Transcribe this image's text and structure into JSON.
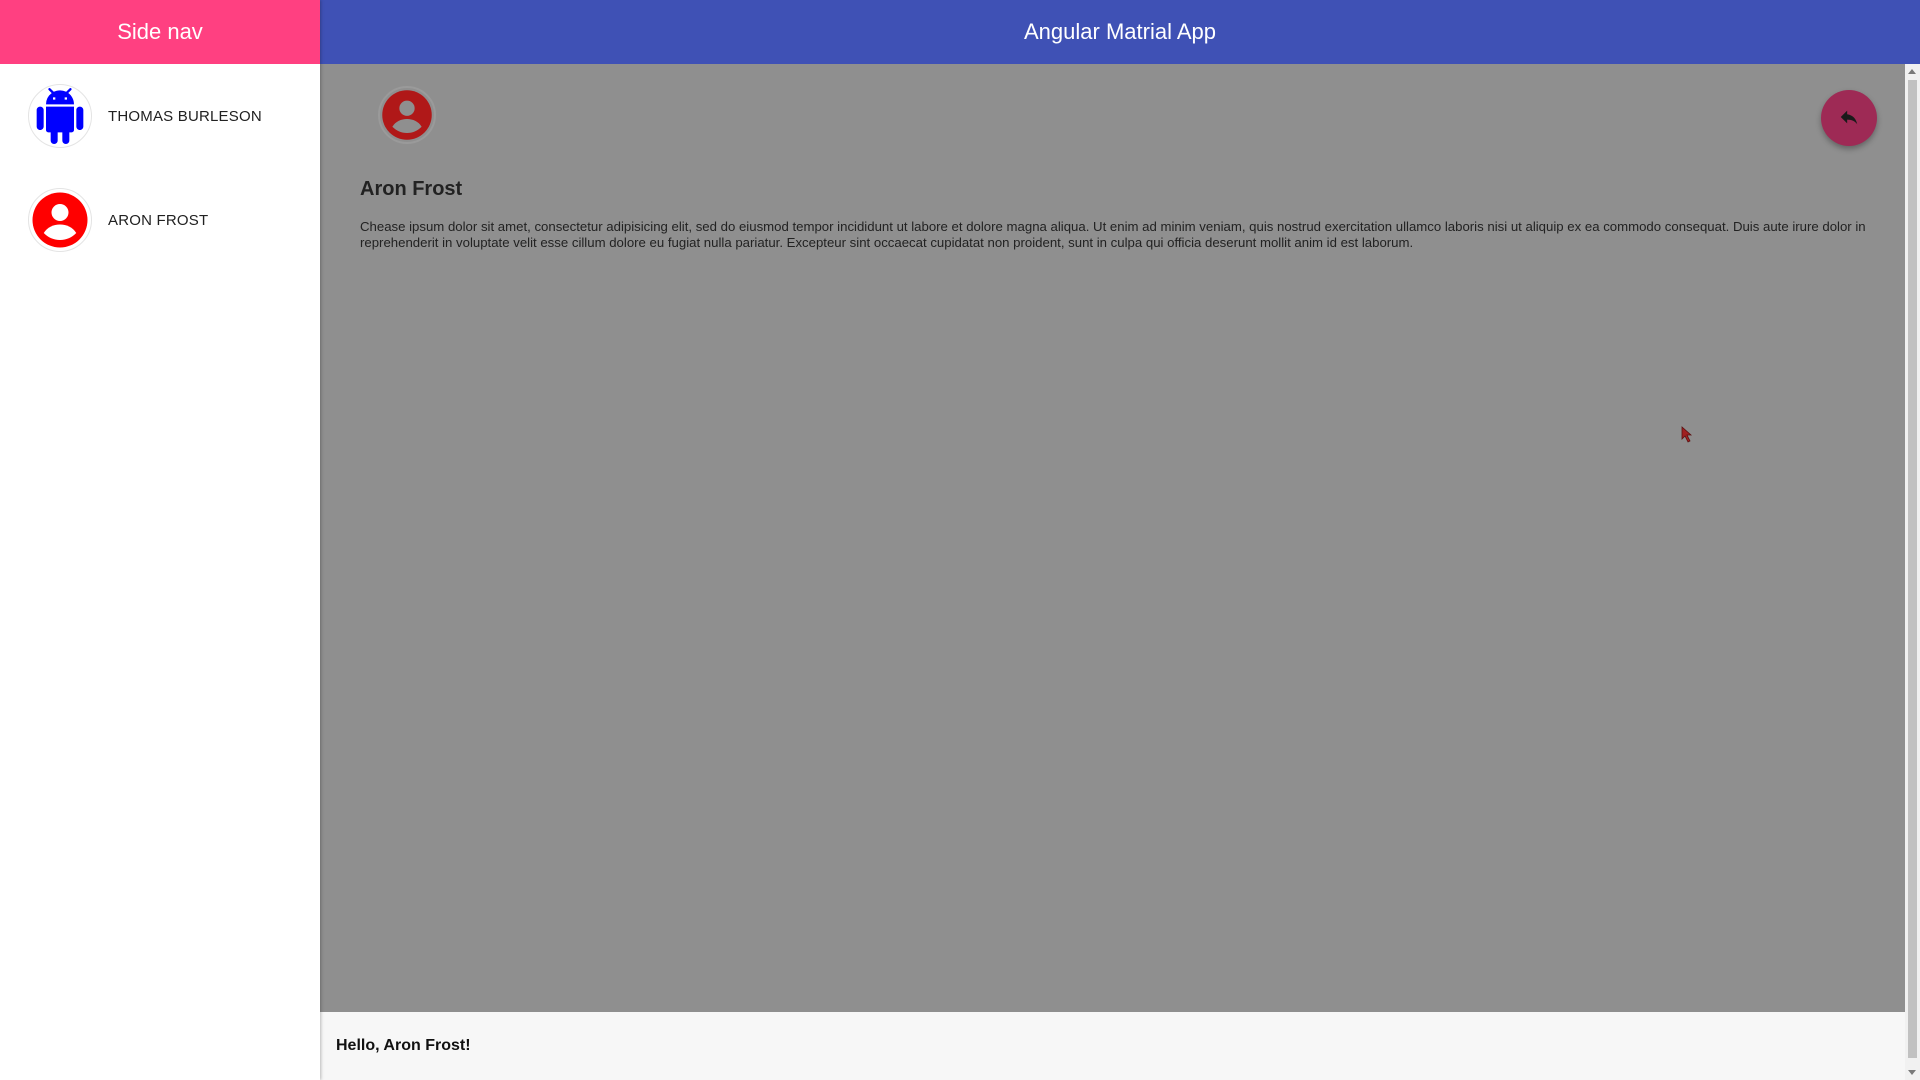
{
  "sidenav": {
    "title": "Side nav",
    "items": [
      {
        "label": "THOMAS BURLESON",
        "icon": "android-icon",
        "color": "#0000ff"
      },
      {
        "label": "ARON FROST",
        "icon": "account-circle-icon",
        "color": "#ff0000"
      }
    ]
  },
  "toolbar": {
    "title": "Angular Matrial App"
  },
  "detail": {
    "name": "Aron Frost",
    "text": "Chease ipsum dolor sit amet, consectetur adipisicing elit, sed do eiusmod tempor incididunt ut labore et dolore magna aliqua. Ut enim ad minim veniam, quis nostrud exercitation ullamco laboris nisi ut aliquip ex ea commodo consequat. Duis aute irure dolor in reprehenderit in voluptate velit esse cillum dolore eu fugiat nulla pariatur. Excepteur sint occaecat cupidatat non proident, sunt in culpa qui officia deserunt mollit anim id est laborum.",
    "avatar_icon": "account-circle-icon",
    "action_icon": "reply-icon"
  },
  "footer": {
    "greeting": "Hello, Aron Frost!"
  },
  "colors": {
    "accent": "#ff4081",
    "primary": "#3f51b5"
  }
}
